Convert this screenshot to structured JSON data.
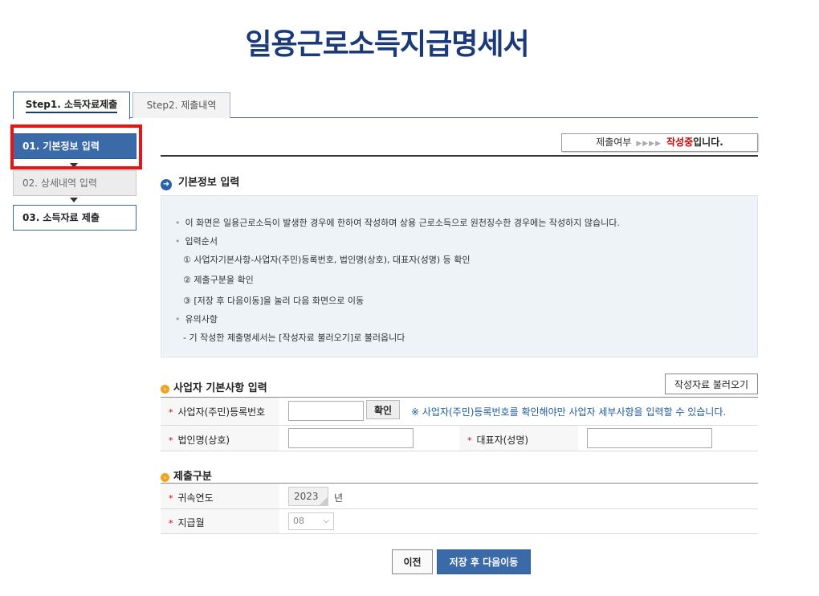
{
  "title": "일용근로소득지급명세서",
  "tabs": [
    {
      "label": "Step1. 소득자료제출",
      "active": true
    },
    {
      "label": "Step2. 제출내역",
      "active": false
    }
  ],
  "steps": [
    {
      "label": "01. 기본정보 입력",
      "state": "current"
    },
    {
      "label": "02. 상세내역 입력",
      "state": "disabled"
    },
    {
      "label": "03. 소득자료 제출",
      "state": "pending"
    }
  ],
  "status": {
    "label": "제출여부",
    "arrows": "▶▶▶▶",
    "value": "작성중",
    "suffix": "입니다."
  },
  "basic_section": {
    "heading": "기본정보 입력",
    "icon": "arrow-right-circle-icon",
    "lines": [
      "이 화면은 일용근로소득이 발생한 경우에 한하여 작성하며 상용 근로소득으로 원천징수한 경우에는 작성하지 않습니다.",
      "입력순서",
      "① 사업자기본사항-사업자(주민)등록번호, 법인명(상호), 대표자(성명) 등 확인",
      "② 제출구분을 확인",
      "③ [저장 후 다음이동]을 눌러 다음 화면으로 이동",
      "유의사항",
      "- 기 작성한 제출명세서는 [작성자료 불러오기]로 불러옵니다"
    ]
  },
  "business_section": {
    "heading": "사업자 기본사항 입력",
    "load_button": "작성자료 불러오기",
    "reg_no_label": "사업자(주민)등록번호",
    "reg_no_value": "",
    "confirm_button": "확인",
    "reg_no_note": "※ 사업자(주민)등록번호를 확인해야만 사업자 세부사항을 입력할 수 있습니다.",
    "corp_name_label": "법인명(상호)",
    "corp_name_value": "",
    "rep_label": "대표자(성명)",
    "rep_value": ""
  },
  "submission_section": {
    "heading": "제출구분",
    "year_label": "귀속연도",
    "year_value": "2023",
    "year_unit": "년",
    "month_label": "지급월",
    "month_value": "08"
  },
  "buttons": {
    "prev": "이전",
    "next": "저장 후 다음이동"
  },
  "colors": {
    "title": "#1b3a7a",
    "active_step": "#3b6aa8",
    "highlight": "#ee1111",
    "status_value": "#d40000",
    "note": "#1f5a9c"
  }
}
